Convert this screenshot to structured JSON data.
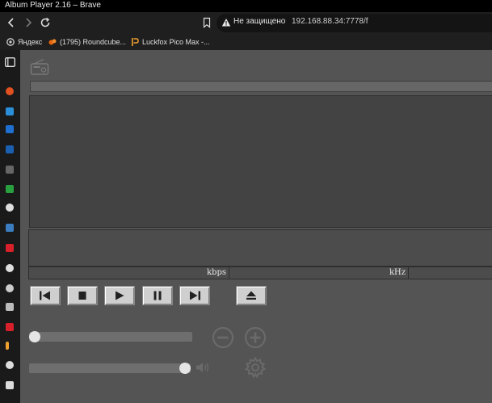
{
  "window": {
    "title": "Album Player 2.16 – Brave"
  },
  "nav": {
    "security_label": "Не защищено",
    "address": "192.168.88.34:7778/f"
  },
  "bookmarks": [
    {
      "label": "Яндекс",
      "icon": "yandex-icon"
    },
    {
      "label": "(1795) Roundcube...",
      "icon": "roundcube-icon"
    },
    {
      "label": "Luckfox Pico Max -...",
      "icon": "luckfox-icon"
    }
  ],
  "player": {
    "radio_icon": "radio-icon",
    "bitrate_unit": "kbps",
    "samplerate_unit": "kHz",
    "controls": [
      {
        "name": "previous",
        "icon": "skip-previous-icon"
      },
      {
        "name": "stop",
        "icon": "stop-icon"
      },
      {
        "name": "play",
        "icon": "play-icon"
      },
      {
        "name": "pause",
        "icon": "pause-icon"
      },
      {
        "name": "next",
        "icon": "skip-next-icon"
      },
      {
        "name": "eject",
        "icon": "eject-icon"
      }
    ],
    "progress_fraction": 0.0,
    "volume_fraction": 1.0,
    "colors": {
      "panel": "#545454",
      "button_face": "#cfcfcf",
      "art_area": "#434343"
    }
  }
}
